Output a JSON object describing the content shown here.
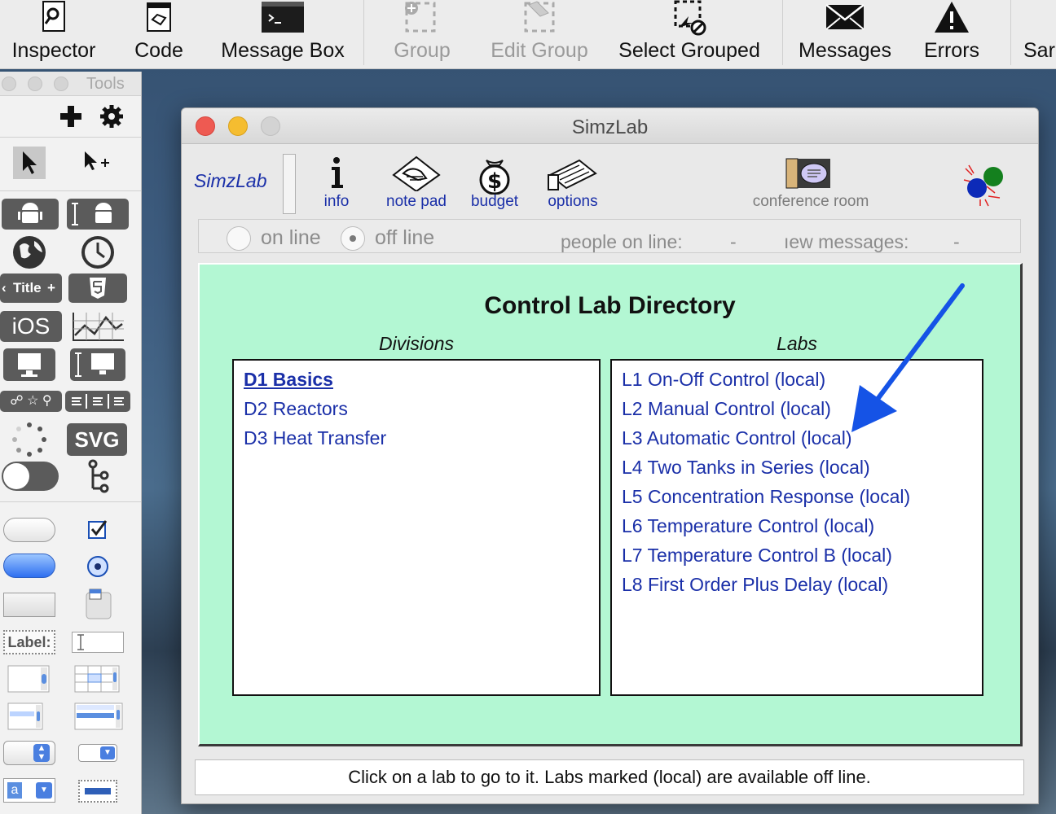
{
  "toolbar": {
    "items": [
      {
        "label": "Inspector",
        "icon": "inspector-icon"
      },
      {
        "label": "Code",
        "icon": "code-icon"
      },
      {
        "label": "Message Box",
        "icon": "message-box-icon"
      },
      {
        "label": "Group",
        "icon": "group-icon",
        "disabled": true
      },
      {
        "label": "Edit Group",
        "icon": "edit-group-icon",
        "disabled": true
      },
      {
        "label": "Select Grouped",
        "icon": "select-grouped-icon"
      },
      {
        "label": "Messages",
        "icon": "messages-icon"
      },
      {
        "label": "Errors",
        "icon": "errors-icon"
      },
      {
        "label": "Sar",
        "icon": ""
      }
    ]
  },
  "tools": {
    "title": "Tools",
    "widget_labels": {
      "title_widget": "Title",
      "ios": "iOS",
      "svg": "SVG",
      "label": "Label:"
    }
  },
  "simz": {
    "title": "SimzLab",
    "brand": "SimzLab",
    "icons": [
      {
        "label": "info",
        "icon": "info-icon"
      },
      {
        "label": "note pad",
        "icon": "note-pad-icon"
      },
      {
        "label": "budget",
        "icon": "budget-icon"
      },
      {
        "label": "options",
        "icon": "options-icon"
      }
    ],
    "conference": "conference room",
    "status": {
      "online": "on line",
      "offline": "off line",
      "offline_selected": true,
      "people": "people on line:",
      "people_value": "-",
      "newmsg": "ıew messages:",
      "newmsg_value": "-"
    },
    "directory": {
      "title": "Control Lab Directory",
      "divisions_head": "Divisions",
      "labs_head": "Labs",
      "divisions": [
        "D1 Basics",
        "D2 Reactors",
        "D3 Heat Transfer"
      ],
      "selected_division": 0,
      "labs": [
        "L1 On-Off Control (local)",
        "L2 Manual Control (local)",
        "L3 Automatic Control (local)",
        "L4 Two Tanks in Series (local)",
        "L5 Concentration Response (local)",
        "L6 Temperature Control (local)",
        "L7 Temperature Control  B (local)",
        "L8 First Order Plus Delay (local)"
      ]
    },
    "hint": "Click on a lab to go to it. Labs marked (local) are available off line."
  },
  "colors": {
    "link_blue": "#1a2fa8",
    "panel_green": "#b3f7d3",
    "annotation_arrow": "#1553e6"
  }
}
